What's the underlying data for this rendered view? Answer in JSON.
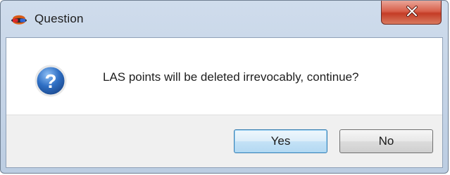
{
  "window": {
    "title": "Question",
    "app_icon": "stereo-glasses-icon",
    "close_icon": "close-icon"
  },
  "dialog": {
    "icon": "question-icon",
    "message": "LAS points will be deleted irrevocably, continue?",
    "buttons": {
      "yes_label": "Yes",
      "no_label": "No"
    }
  },
  "colors": {
    "close_button": "#c94a34",
    "question_icon": "#2f6fc4",
    "default_button_border": "#3c7fb1"
  }
}
